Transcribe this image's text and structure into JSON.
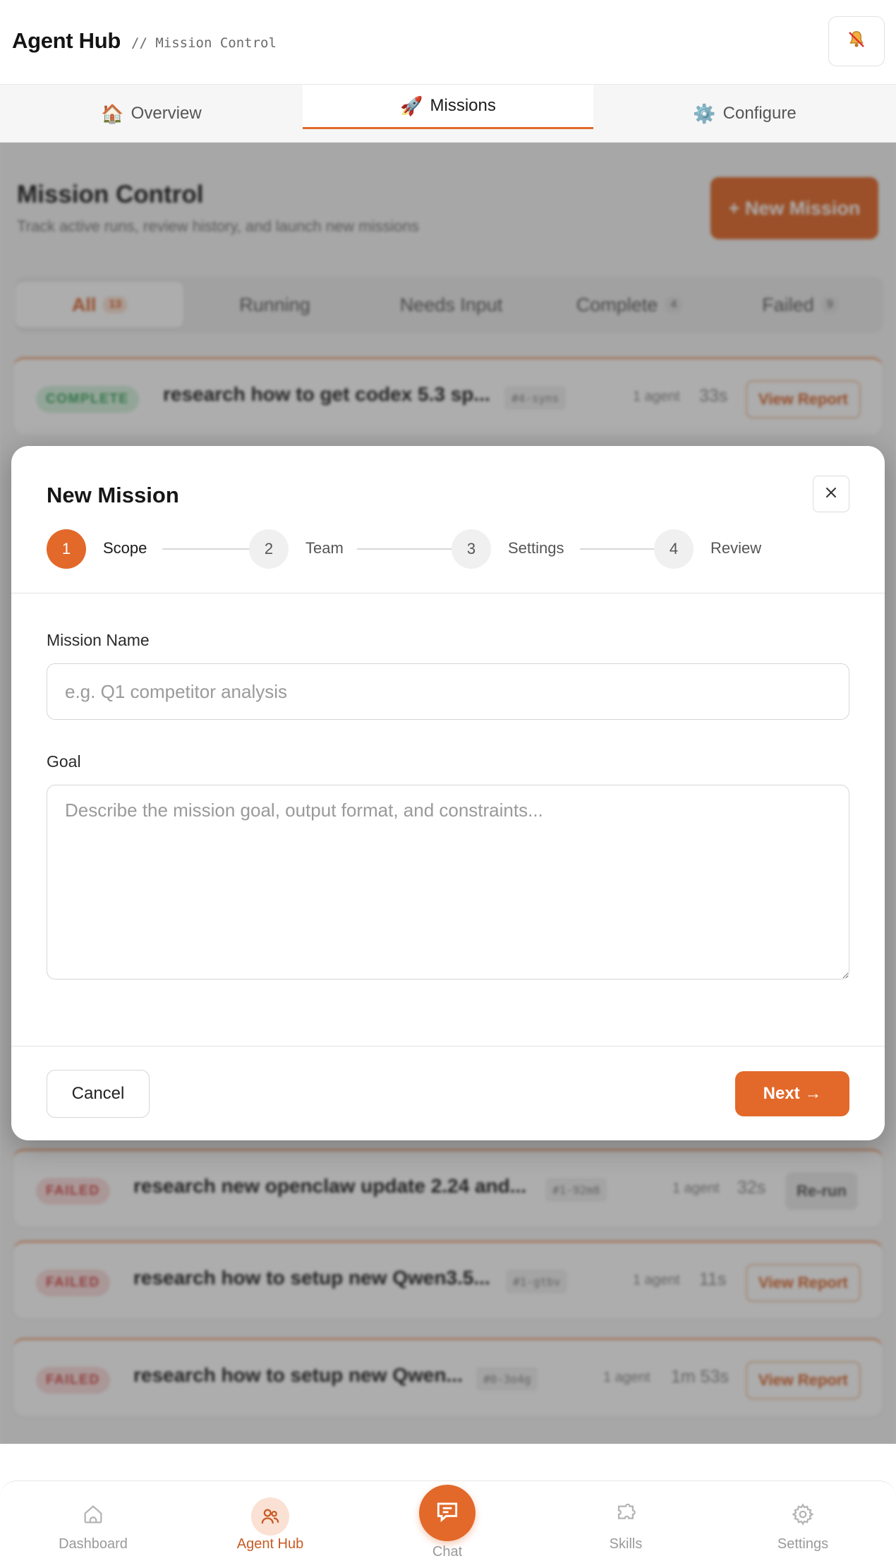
{
  "header": {
    "title": "Agent Hub",
    "subtitle": "// Mission Control",
    "bell_icon": "bell-off-icon"
  },
  "tabs": [
    {
      "emoji": "🏠",
      "label": "Overview",
      "active": false
    },
    {
      "emoji": "🚀",
      "label": "Missions",
      "active": true
    },
    {
      "emoji": "⚙️",
      "label": "Configure",
      "active": false
    }
  ],
  "page": {
    "title": "Mission Control",
    "subtitle": "Track active runs, review history, and launch new missions",
    "new_mission_label": "+ New Mission"
  },
  "filters": [
    {
      "label": "All",
      "count": "13",
      "active": true
    },
    {
      "label": "Running",
      "count": "",
      "active": false
    },
    {
      "label": "Needs Input",
      "count": "",
      "active": false
    },
    {
      "label": "Complete",
      "count": "4",
      "active": false
    },
    {
      "label": "Failed",
      "count": "9",
      "active": false
    }
  ],
  "missions": [
    {
      "status": "COMPLETE",
      "title": "research how to get codex 5.3 sp...",
      "tag": "#4-syns",
      "agents": "1 agent",
      "time": "33s",
      "action": "View Report"
    },
    {
      "status": "FAILED",
      "title": "research new openclaw update 2.24 and...",
      "tag": "#1-92m8",
      "agents": "1 agent",
      "time": "32s",
      "action": "Re-run"
    },
    {
      "status": "FAILED",
      "title": "research how to setup new Qwen3.5...",
      "tag": "#1-gtbv",
      "agents": "1 agent",
      "time": "11s",
      "action": "View Report"
    },
    {
      "status": "FAILED",
      "title": "research how to setup new Qwen...",
      "tag": "#0-3o4g",
      "agents": "1 agent",
      "time": "1m 53s",
      "action": "View Report"
    }
  ],
  "modal": {
    "title": "New Mission",
    "steps": [
      {
        "number": "1",
        "label": "Scope",
        "active": true
      },
      {
        "number": "2",
        "label": "Team",
        "active": false
      },
      {
        "number": "3",
        "label": "Settings",
        "active": false
      },
      {
        "number": "4",
        "label": "Review",
        "active": false
      }
    ],
    "mission_name_label": "Mission Name",
    "mission_name_placeholder": "e.g. Q1 competitor analysis",
    "mission_name_value": "",
    "goal_label": "Goal",
    "goal_placeholder": "Describe the mission goal, output format, and constraints...",
    "goal_value": "",
    "cancel_label": "Cancel",
    "next_label": "Next →"
  },
  "bottom_nav": [
    {
      "label": "Dashboard",
      "icon": "home-icon",
      "active": false
    },
    {
      "label": "Agent Hub",
      "icon": "users-icon",
      "active": true
    },
    {
      "label": "Chat",
      "icon": "chat-icon",
      "active": false
    },
    {
      "label": "Skills",
      "icon": "puzzle-icon",
      "active": false
    },
    {
      "label": "Settings",
      "icon": "gear-icon",
      "active": false
    }
  ],
  "colors": {
    "accent": "#e2692a",
    "complete": "#3aa55e",
    "failed": "#d34c4c"
  }
}
